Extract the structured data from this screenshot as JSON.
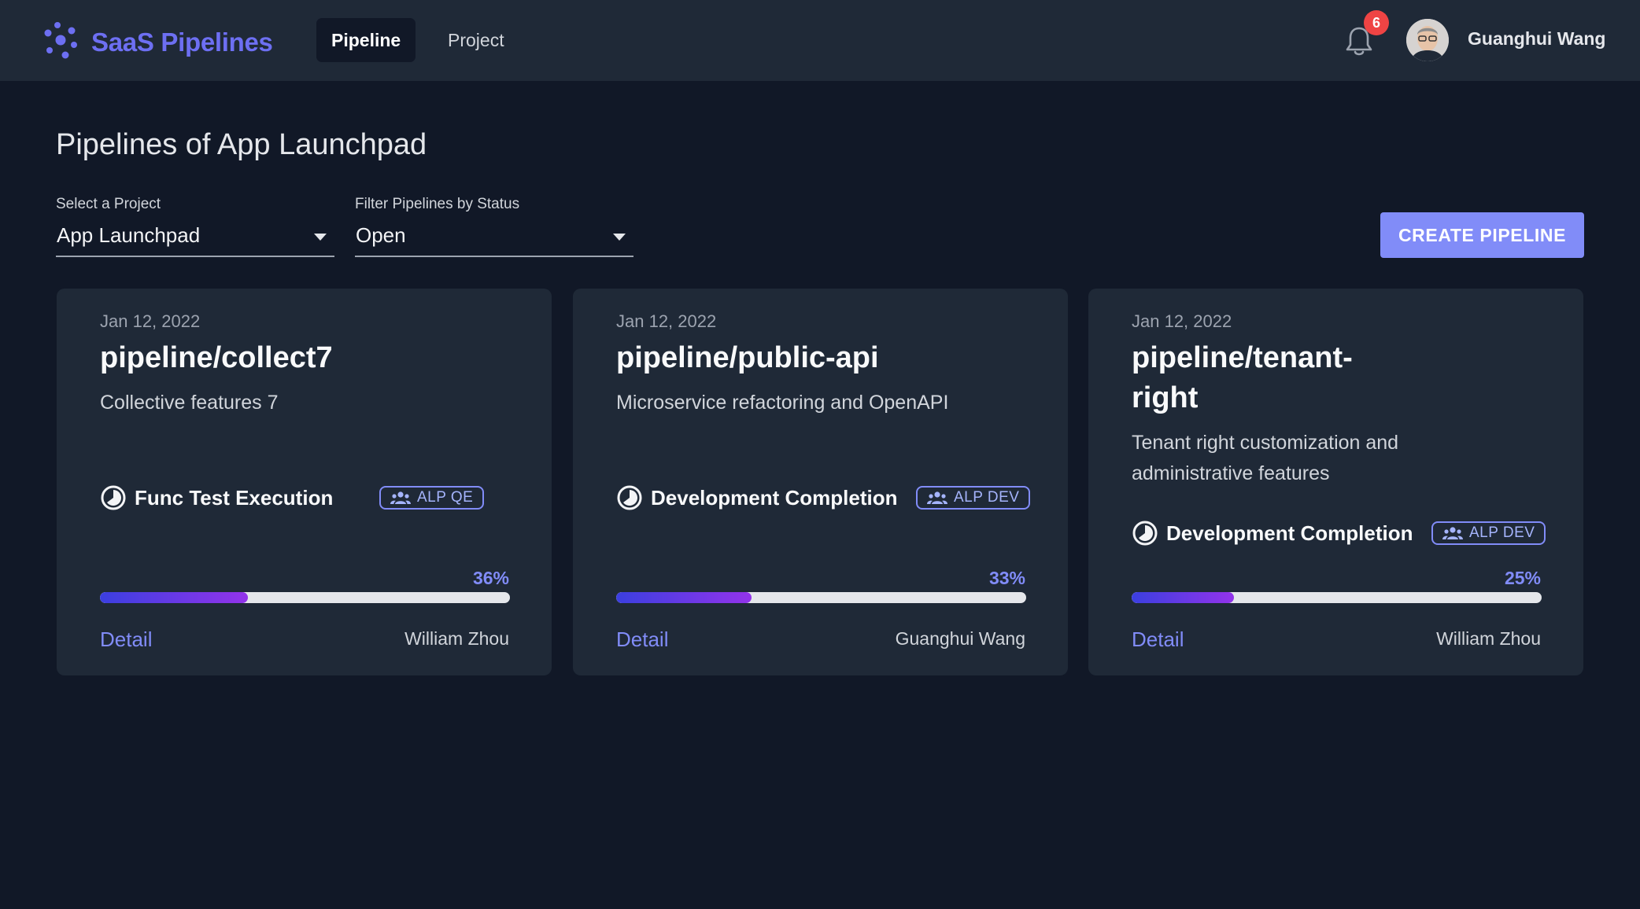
{
  "header": {
    "brand": "SaaS Pipelines",
    "tabs": [
      {
        "label": "Pipeline",
        "active": true
      },
      {
        "label": "Project",
        "active": false
      }
    ],
    "notification_count": "6",
    "user_name": "Guanghui Wang"
  },
  "main": {
    "title": "Pipelines of App Launchpad",
    "project_select": {
      "label": "Select a Project",
      "value": "App Launchpad"
    },
    "status_select": {
      "label": "Filter Pipelines by Status",
      "value": "Open"
    },
    "create_button": "CREATE PIPELINE"
  },
  "colors": {
    "accent": "#818cf8",
    "brand": "#6d6ff2",
    "background": "#111827",
    "card": "#1f2937",
    "badge": "#ef4444"
  },
  "pipelines": [
    {
      "date": "Jan 12, 2022",
      "name": "pipeline/collect7",
      "description": "Collective features 7",
      "stage": "Func Test Execution",
      "team": "ALP QE",
      "progress": 36,
      "progress_label": "36%",
      "detail_label": "Detail",
      "owner": "William Zhou"
    },
    {
      "date": "Jan 12, 2022",
      "name": "pipeline/public-api",
      "description": "Microservice refactoring and OpenAPI",
      "stage": "Development Completion",
      "team": "ALP DEV",
      "progress": 33,
      "progress_label": "33%",
      "detail_label": "Detail",
      "owner": "Guanghui Wang"
    },
    {
      "date": "Jan 12, 2022",
      "name": "pipeline/tenant-right",
      "description": "Tenant right customization and administrative features",
      "stage": "Development Completion",
      "team": "ALP DEV",
      "progress": 25,
      "progress_label": "25%",
      "detail_label": "Detail",
      "owner": "William Zhou"
    }
  ]
}
